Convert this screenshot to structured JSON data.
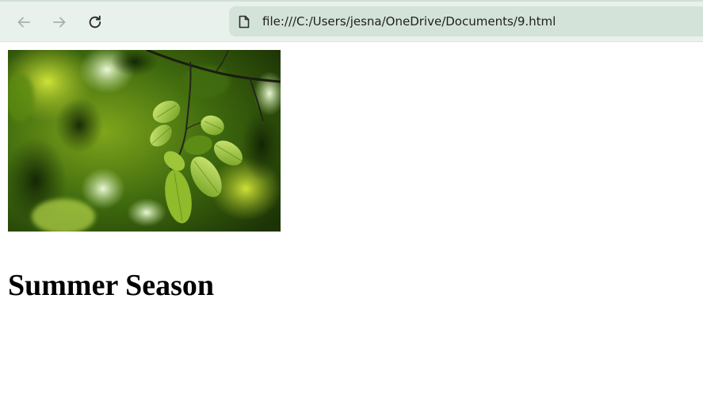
{
  "browser": {
    "url": "file:///C:/Users/jesna/OneDrive/Documents/9.html",
    "icons": {
      "back": "back-arrow-icon",
      "forward": "forward-arrow-icon",
      "reload": "reload-icon",
      "page": "file-page-icon"
    }
  },
  "page": {
    "heading": "Summer Season"
  },
  "colors": {
    "toolbar_bg": "#e9f1ec",
    "address_bar_bg": "#d3e3da"
  }
}
